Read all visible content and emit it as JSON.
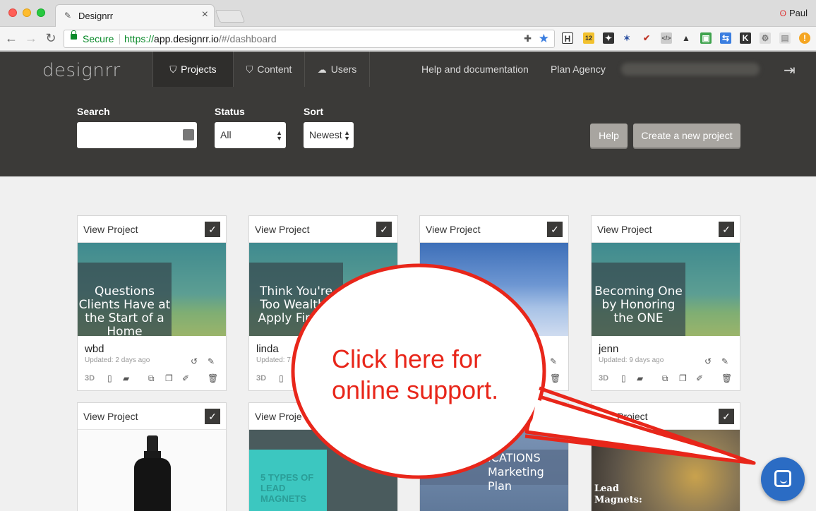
{
  "browser": {
    "tab_title": "Designrr",
    "profile_name": "Paul",
    "secure_label": "Secure",
    "url_scheme": "https://",
    "url_host": "app.designrr.io",
    "url_path": "/#/dashboard",
    "extensions": [
      "H",
      "12",
      "K"
    ]
  },
  "app": {
    "logo": "designrr",
    "tabs": [
      {
        "label": "Projects",
        "icon": "projects-icon",
        "active": true
      },
      {
        "label": "Content",
        "icon": "content-icon",
        "active": false
      },
      {
        "label": "Users",
        "icon": "users-icon",
        "active": false
      }
    ],
    "links": {
      "help": "Help and documentation",
      "plan": "Plan Agency"
    }
  },
  "filters": {
    "search_label": "Search",
    "search_value": "",
    "status_label": "Status",
    "status_value": "All",
    "sort_label": "Sort",
    "sort_value": "Newest",
    "help_button": "Help",
    "create_button": "Create a new project"
  },
  "cards": [
    {
      "header": "View Project",
      "thumb_title": "Questions Clients Have at the Start of a Home",
      "name": "wbd",
      "updated": "Updated: 2 days ago"
    },
    {
      "header": "View Project",
      "thumb_title": "Think You're Too Wealthy Apply Financ",
      "name": "linda",
      "updated": "Updated: 7"
    },
    {
      "header": "View Project",
      "thumb_title": "",
      "name": "",
      "updated": ""
    },
    {
      "header": "View Project",
      "thumb_title": "Becoming One by Honoring the ONE",
      "name": "jenn",
      "updated": "Updated: 9 days ago"
    },
    {
      "header": "View Project",
      "thumb_title": "",
      "name": "",
      "updated": ""
    },
    {
      "header": "View Proje",
      "thumb_title": "5 TYPES OF LEAD MAGNETS",
      "name": "",
      "updated": ""
    },
    {
      "header": "",
      "thumb_title": "ICATIONS Marketing Plan",
      "name": "",
      "updated": ""
    },
    {
      "header": "Project",
      "thumb_title": "Lead Magnets:",
      "name": "",
      "updated": ""
    }
  ],
  "card_actions": {
    "three_d": "3D"
  },
  "callout": {
    "line1": "Click here for",
    "line2": "online support."
  },
  "colors": {
    "header_bg": "#3b3a38",
    "callout_red": "#e8261a",
    "support_blue": "#2b6cc4",
    "secure_green": "#0a8a2a"
  }
}
